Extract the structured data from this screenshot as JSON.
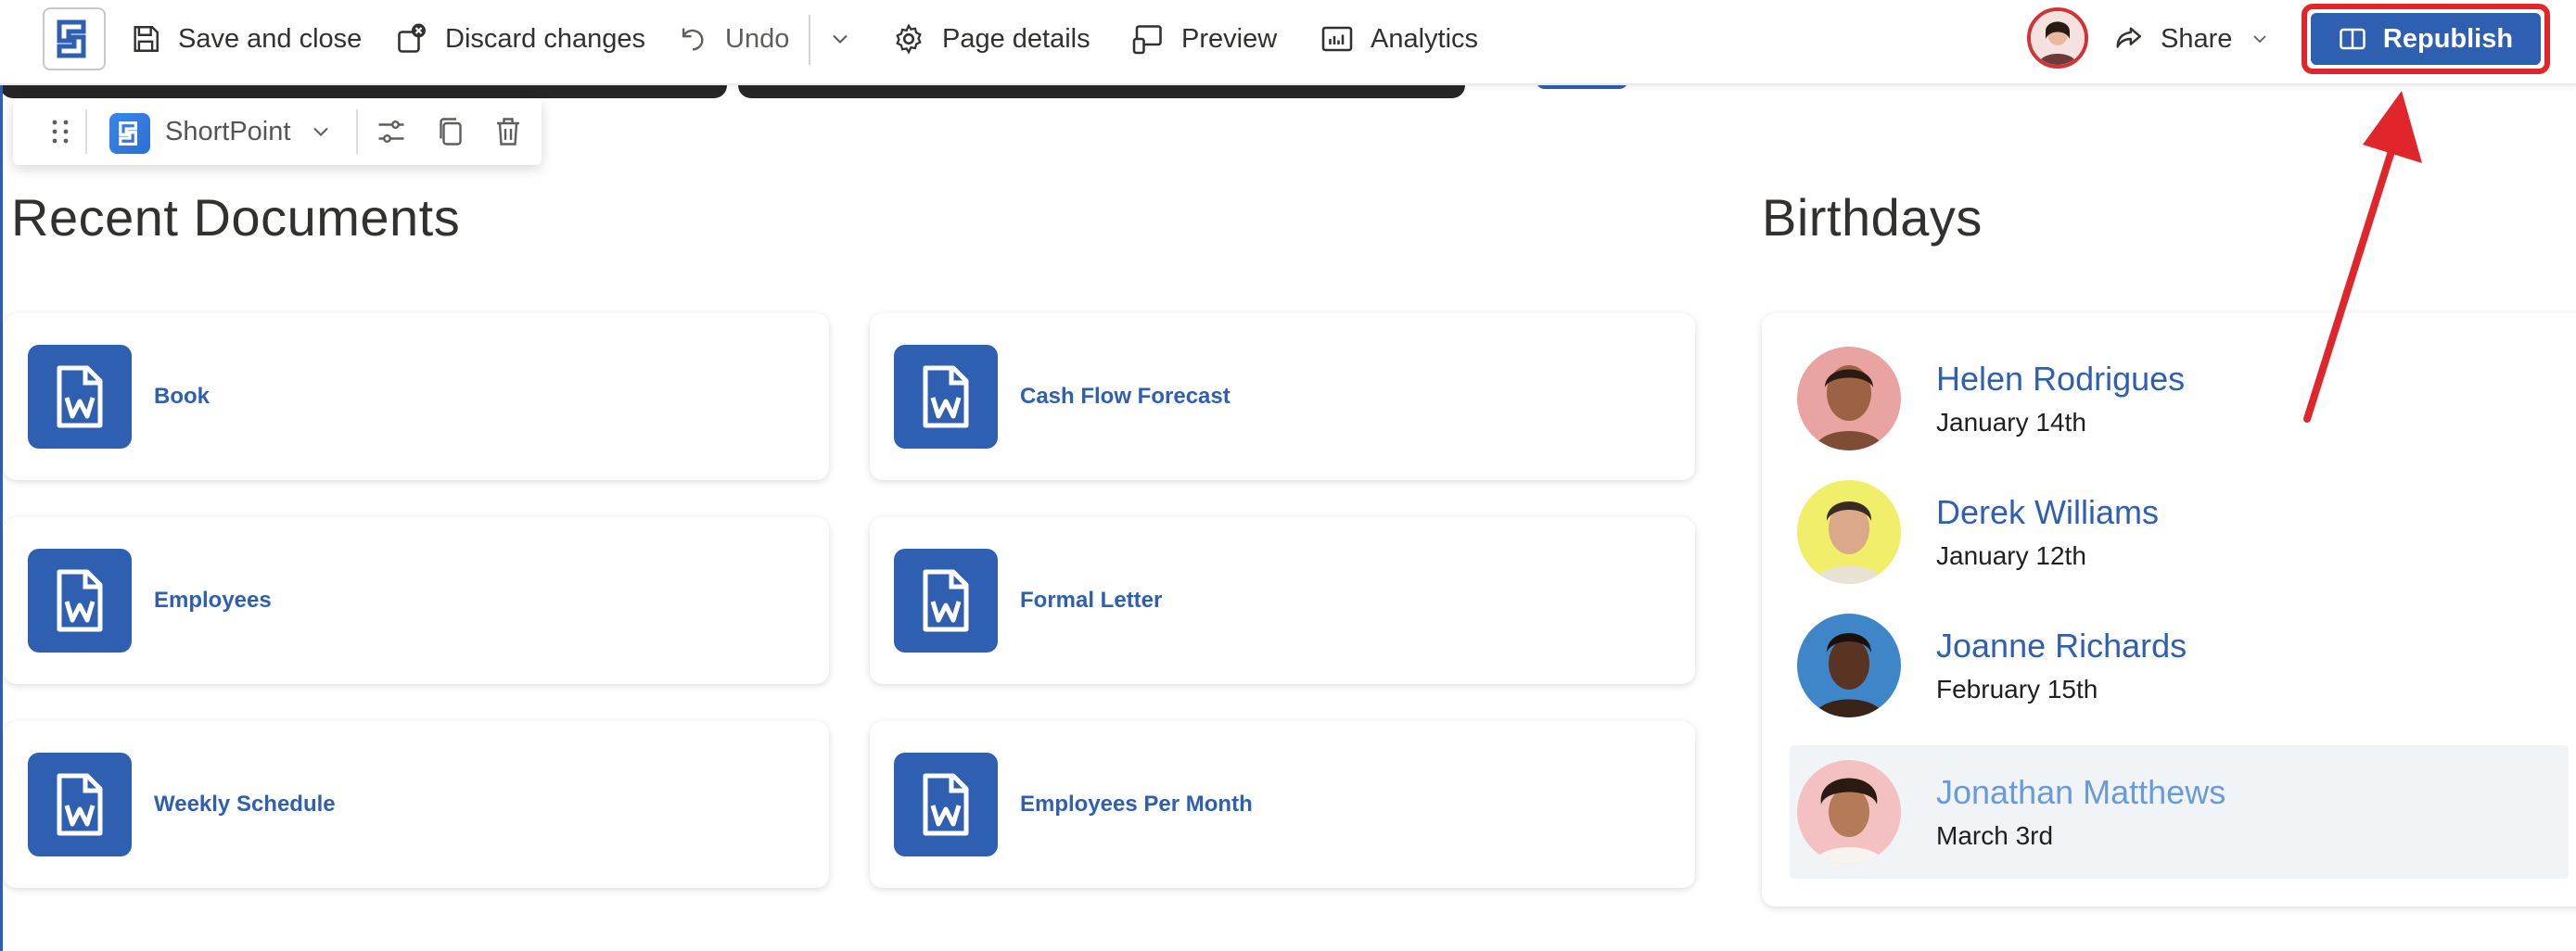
{
  "commandbar": {
    "save_close": "Save and close",
    "discard": "Discard changes",
    "undo": "Undo",
    "page_details": "Page details",
    "preview": "Preview",
    "analytics": "Analytics",
    "share": "Share",
    "republish": "Republish"
  },
  "webpart_toolbar": {
    "name": "ShortPoint"
  },
  "recent_documents": {
    "title": "Recent Documents",
    "items": [
      {
        "name": "Book",
        "icon": "word-document-icon"
      },
      {
        "name": "Cash Flow Forecast",
        "icon": "word-document-icon"
      },
      {
        "name": "Employees",
        "icon": "word-document-icon"
      },
      {
        "name": "Formal Letter",
        "icon": "word-document-icon"
      },
      {
        "name": "Weekly Schedule",
        "icon": "word-document-icon"
      },
      {
        "name": "Employees Per Month",
        "icon": "word-document-icon"
      }
    ]
  },
  "birthdays": {
    "title": "Birthdays",
    "people": [
      {
        "name": "Helen Rodrigues",
        "date": "January 14th"
      },
      {
        "name": "Derek Williams",
        "date": "January 12th"
      },
      {
        "name": "Joanne Richards",
        "date": "February 15th"
      },
      {
        "name": "Jonathan Matthews",
        "date": "March 3rd"
      }
    ]
  },
  "colors": {
    "accent": "#2f5fb0",
    "annotation": "#e0262b"
  }
}
